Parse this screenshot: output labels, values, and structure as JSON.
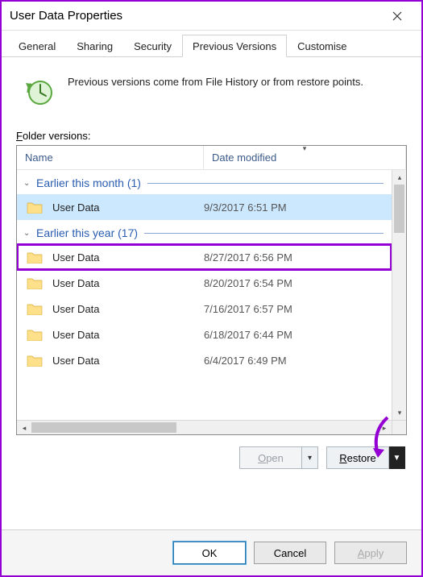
{
  "window": {
    "title": "User Data Properties"
  },
  "tabs": {
    "general": "General",
    "sharing": "Sharing",
    "security": "Security",
    "previous": "Previous Versions",
    "customise": "Customise",
    "active": "previous"
  },
  "info": {
    "text": "Previous versions come from File History or from restore points."
  },
  "versions_label": "Folder versions:",
  "columns": {
    "name": "Name",
    "date": "Date modified"
  },
  "groups": [
    {
      "title": "Earlier this month (1)",
      "rows": [
        {
          "name": "User Data",
          "date": "9/3/2017 6:51 PM",
          "selected": true
        }
      ]
    },
    {
      "title": "Earlier this year (17)",
      "rows": [
        {
          "name": "User Data",
          "date": "8/27/2017 6:56 PM",
          "highlight": true
        },
        {
          "name": "User Data",
          "date": "8/20/2017 6:54 PM"
        },
        {
          "name": "User Data",
          "date": "7/16/2017 6:57 PM"
        },
        {
          "name": "User Data",
          "date": "6/18/2017 6:44 PM"
        },
        {
          "name": "User Data",
          "date": "6/4/2017 6:49 PM"
        }
      ]
    }
  ],
  "actions": {
    "open": "Open",
    "restore": "Restore"
  },
  "footer": {
    "ok": "OK",
    "cancel": "Cancel",
    "apply": "Apply"
  }
}
